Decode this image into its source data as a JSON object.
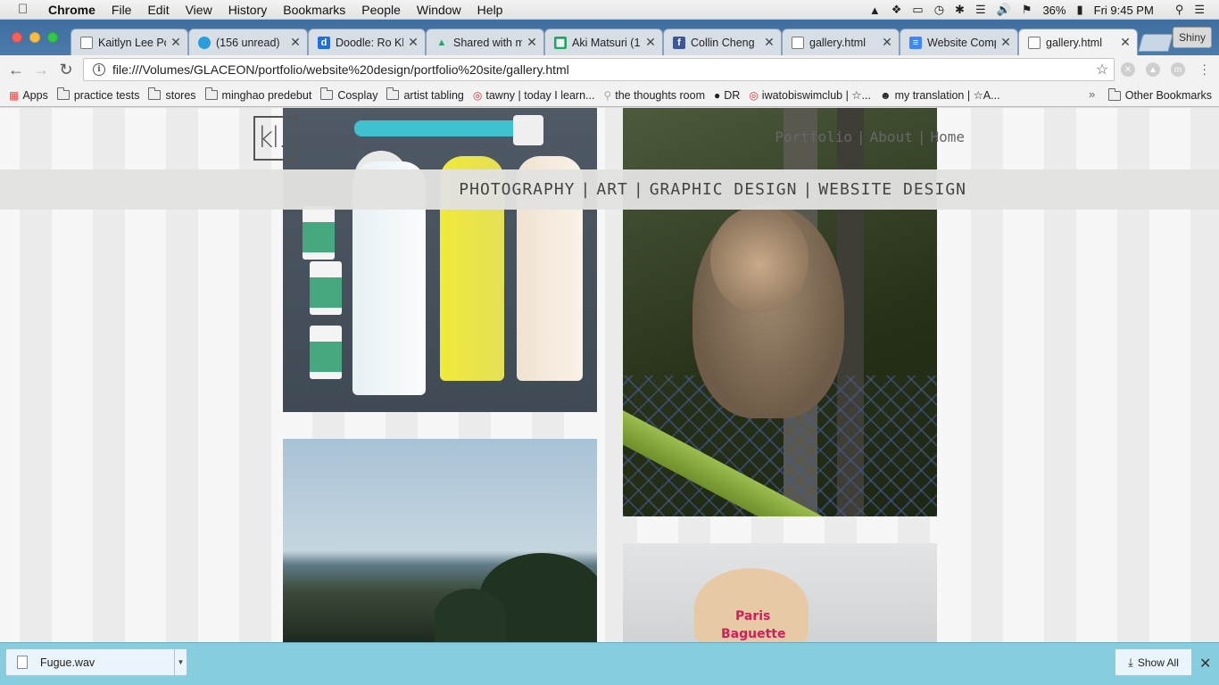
{
  "menubar": {
    "app": "Chrome",
    "items": [
      "File",
      "Edit",
      "View",
      "History",
      "Bookmarks",
      "People",
      "Window",
      "Help"
    ],
    "battery": "36%",
    "clock": "Fri 9:45 PM"
  },
  "tabs": [
    {
      "title": "Kaitlyn Lee Po",
      "icon": "page-icon"
    },
    {
      "title": "(156 unread)",
      "icon": "att-globe-icon"
    },
    {
      "title": "Doodle: Ro Kl",
      "icon": "doodle-d-icon"
    },
    {
      "title": "Shared with m",
      "icon": "google-drive-icon"
    },
    {
      "title": "Aki Matsuri (1",
      "icon": "google-sheets-icon"
    },
    {
      "title": "Collin Cheng",
      "icon": "facebook-icon"
    },
    {
      "title": "gallery.html",
      "icon": "page-icon"
    },
    {
      "title": "Website Comp",
      "icon": "google-docs-icon"
    },
    {
      "title": "gallery.html",
      "icon": "page-icon"
    }
  ],
  "profile_button": "Shiny",
  "toolbar": {
    "url": "file:///Volumes/GLACEON/portfolio/website%20design/portfolio%20site/gallery.html"
  },
  "bookmarks": {
    "apps": "Apps",
    "items": [
      {
        "label": "practice tests",
        "type": "folder"
      },
      {
        "label": "stores",
        "type": "folder"
      },
      {
        "label": "minghao predebut",
        "type": "folder"
      },
      {
        "label": "Cosplay",
        "type": "folder"
      },
      {
        "label": "artist tabling",
        "type": "folder"
      },
      {
        "label": "tawny | today I learn...",
        "type": "link"
      },
      {
        "label": "the thoughts room",
        "type": "link"
      },
      {
        "label": "DR",
        "type": "link"
      },
      {
        "label": "iwatobiswimclub | ☆...",
        "type": "link"
      },
      {
        "label": "my translation | ☆A...",
        "type": "link"
      }
    ],
    "overflow": "»",
    "other": "Other Bookmarks"
  },
  "site": {
    "logo": "kl.",
    "topnav": [
      "Portfolio",
      "About",
      "Home"
    ],
    "categories": [
      "PHOTOGRAPHY",
      "ART",
      "GRAPHIC DESIGN",
      "WEBSITE DESIGN"
    ],
    "container_label_line1": "Paris",
    "container_label_line2": "Baguette"
  },
  "downloads": {
    "file": "Fugue.wav",
    "show_all": "Show All"
  },
  "colors": {
    "tabstrip": "#4b7bab",
    "download_bar": "#86cde0",
    "category_bar": "#e2e2e0"
  }
}
